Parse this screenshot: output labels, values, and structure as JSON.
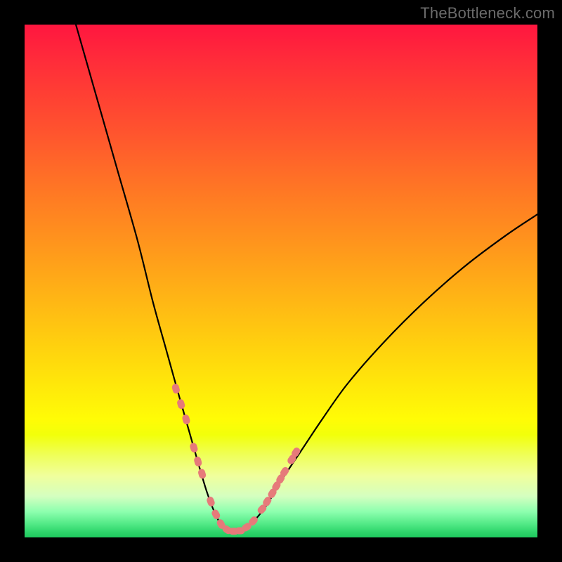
{
  "watermark": "TheBottleneck.com",
  "colors": {
    "frame": "#000000",
    "curve": "#000000",
    "marker_fill": "#e67a7a",
    "marker_stroke": "#d96666"
  },
  "chart_data": {
    "type": "line",
    "title": "",
    "xlabel": "",
    "ylabel": "",
    "xlim": [
      0,
      100
    ],
    "ylim": [
      0,
      100
    ],
    "grid": false,
    "legend": false,
    "notes": "Bottleneck-style V-curve. x is a normalized hardware-balance axis (0–100). y is bottleneck percentage (0 = ideal at the valley, 100 = severe). Background gradient encodes y: green near 0, red near 100. No numeric axis ticks are drawn in the source image; values below are read from curve geometry against the implied 0–100 scale.",
    "series": [
      {
        "name": "bottleneck_curve",
        "x": [
          10,
          14,
          18,
          22,
          25,
          27.5,
          30,
          32,
          34,
          35.5,
          37,
          38.5,
          40,
          42,
          44,
          47,
          50,
          54,
          58,
          63,
          70,
          78,
          86,
          94,
          100
        ],
        "y": [
          100,
          86,
          72,
          58,
          46,
          37,
          28,
          21,
          14,
          9,
          5,
          2.2,
          1.2,
          1.2,
          2.5,
          6,
          11,
          17,
          23,
          30,
          38,
          46,
          53,
          59,
          63
        ]
      }
    ],
    "markers": {
      "name": "highlighted_segments",
      "style": "rounded-dash",
      "color": "#e67a7a",
      "points_x": [
        29.5,
        30.5,
        31.5,
        33.0,
        33.8,
        34.6,
        36.3,
        37.3,
        38.3,
        39.5,
        40.8,
        42.0,
        43.3,
        44.6,
        46.3,
        47.3,
        48.3,
        49.1,
        49.9,
        50.7,
        52.1,
        52.9
      ],
      "points_y": [
        29.0,
        26.0,
        23.0,
        17.5,
        14.8,
        12.4,
        7.0,
        4.5,
        2.6,
        1.5,
        1.2,
        1.3,
        2.0,
        3.2,
        5.5,
        7.0,
        8.6,
        10.0,
        11.4,
        12.8,
        15.2,
        16.6
      ]
    }
  }
}
